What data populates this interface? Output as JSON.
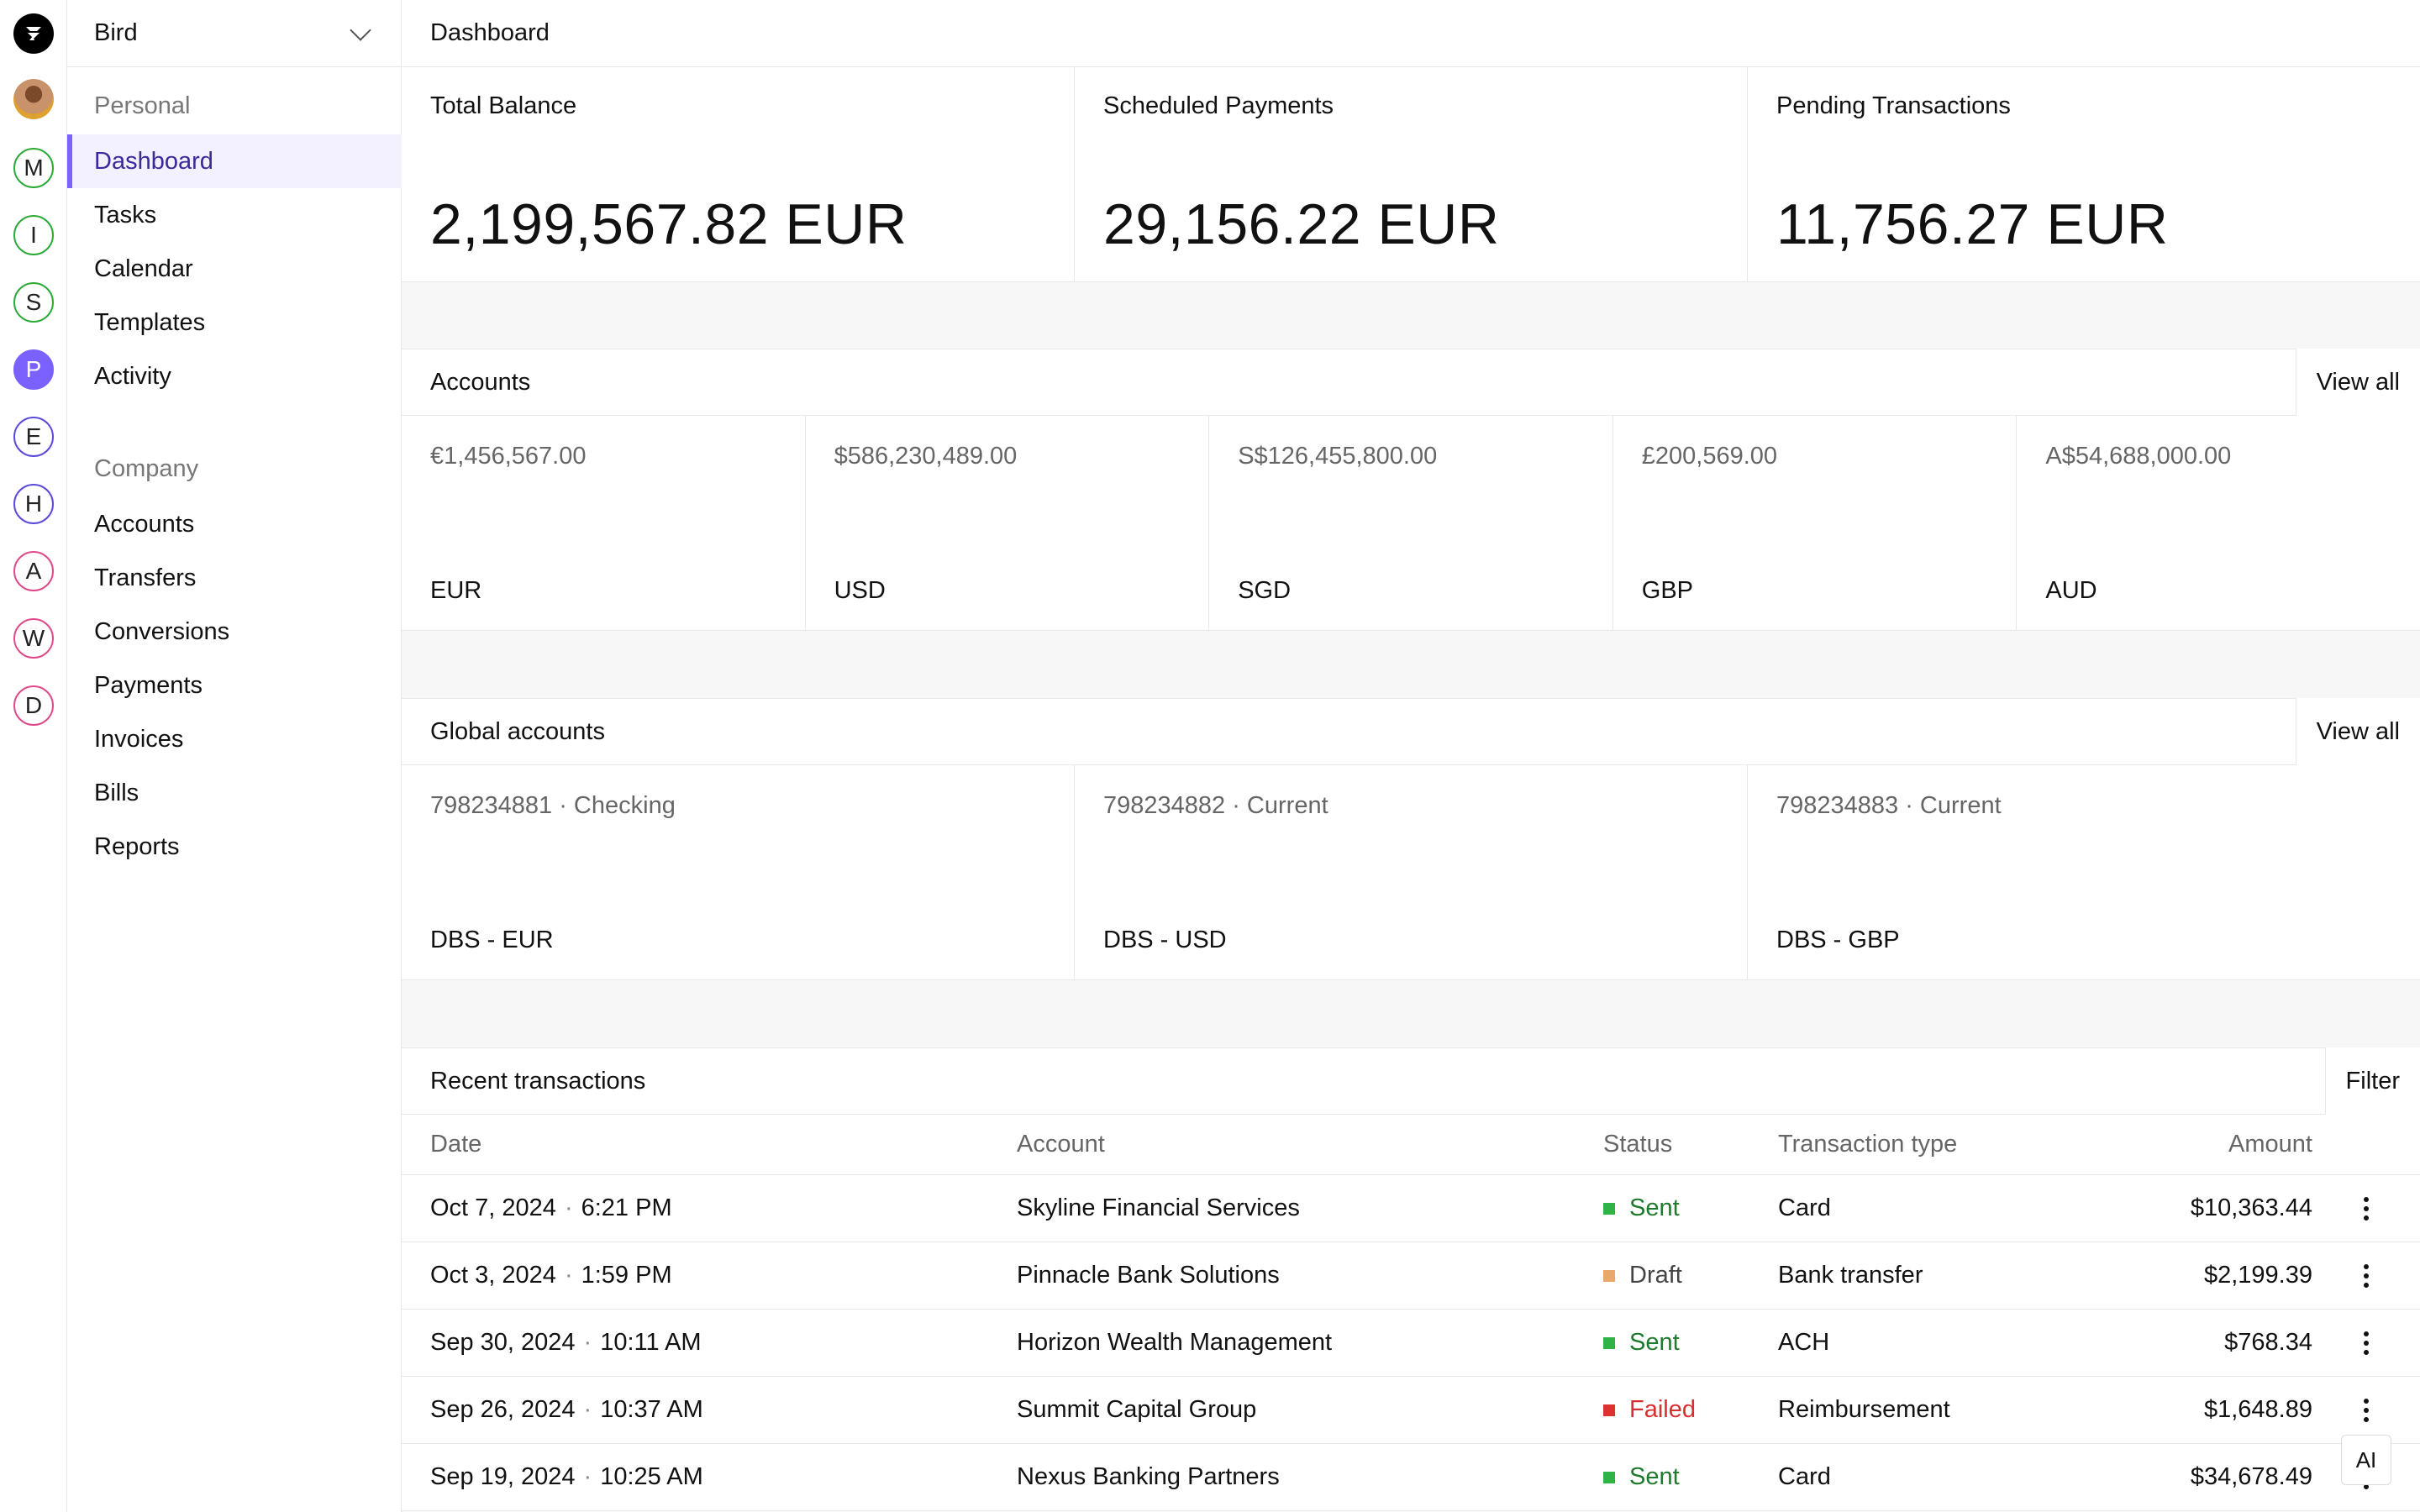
{
  "rail": {
    "workspaces": [
      {
        "letter": "M",
        "style": "green"
      },
      {
        "letter": "I",
        "style": "green"
      },
      {
        "letter": "S",
        "style": "green"
      },
      {
        "letter": "P",
        "style": "filled"
      },
      {
        "letter": "E",
        "style": "purple"
      },
      {
        "letter": "H",
        "style": "purple"
      },
      {
        "letter": "A",
        "style": "pink"
      },
      {
        "letter": "W",
        "style": "pink"
      },
      {
        "letter": "D",
        "style": "pink"
      }
    ]
  },
  "sidebar": {
    "org_name": "Bird",
    "personal_label": "Personal",
    "personal_items": [
      "Dashboard",
      "Tasks",
      "Calendar",
      "Templates",
      "Activity"
    ],
    "company_label": "Company",
    "company_items": [
      "Accounts",
      "Transfers",
      "Conversions",
      "Payments",
      "Invoices",
      "Bills",
      "Reports"
    ]
  },
  "header": {
    "title": "Dashboard"
  },
  "stats": [
    {
      "label": "Total Balance",
      "value": "2,199,567.82 EUR"
    },
    {
      "label": "Scheduled Payments",
      "value": "29,156.22 EUR"
    },
    {
      "label": "Pending Transactions",
      "value": "11,756.27 EUR"
    }
  ],
  "accounts": {
    "title": "Accounts",
    "view_all": "View all",
    "items": [
      {
        "amount": "€1,456,567.00",
        "currency": "EUR"
      },
      {
        "amount": "$586,230,489.00",
        "currency": "USD"
      },
      {
        "amount": "S$126,455,800.00",
        "currency": "SGD"
      },
      {
        "amount": "£200,569.00",
        "currency": "GBP"
      },
      {
        "amount": "A$54,688,000.00",
        "currency": "AUD"
      }
    ]
  },
  "global_accounts": {
    "title": "Global accounts",
    "view_all": "View all",
    "items": [
      {
        "number": "798234881 · Checking",
        "name": "DBS - EUR"
      },
      {
        "number": "798234882 · Current",
        "name": "DBS - USD"
      },
      {
        "number": "798234883 · Current",
        "name": "DBS - GBP"
      }
    ]
  },
  "transactions": {
    "title": "Recent transactions",
    "filter": "Filter",
    "columns": {
      "date": "Date",
      "account": "Account",
      "status": "Status",
      "type": "Transaction type",
      "amount": "Amount"
    },
    "rows": [
      {
        "date": "Oct 7, 2024",
        "sep": "·",
        "time": "6:21 PM",
        "account": "Skyline Financial Services",
        "status": "Sent",
        "type": "Card",
        "amount": "$10,363.44"
      },
      {
        "date": "Oct 3, 2024",
        "sep": "·",
        "time": "1:59 PM",
        "account": "Pinnacle Bank Solutions",
        "status": "Draft",
        "type": "Bank transfer",
        "amount": "$2,199.39"
      },
      {
        "date": "Sep 30, 2024",
        "sep": "·",
        "time": "10:11 AM",
        "account": "Horizon Wealth Management",
        "status": "Sent",
        "type": "ACH",
        "amount": "$768.34"
      },
      {
        "date": "Sep 26, 2024",
        "sep": "·",
        "time": "10:37 AM",
        "account": "Summit Capital Group",
        "status": "Failed",
        "type": "Reimbursement",
        "amount": "$1,648.89"
      },
      {
        "date": "Sep 19, 2024",
        "sep": "·",
        "time": "10:25 AM",
        "account": "Nexus Banking Partners",
        "status": "Sent",
        "type": "Card",
        "amount": "$34,678.49"
      }
    ]
  },
  "status_colors": {
    "Sent": "#2fb344",
    "Draft": "#e8a86a",
    "Failed": "#e03131"
  },
  "status_text_colors": {
    "Sent": "#1f7a2e",
    "Draft": "#444444",
    "Failed": "#d62f2f"
  },
  "ai_button": "AI"
}
